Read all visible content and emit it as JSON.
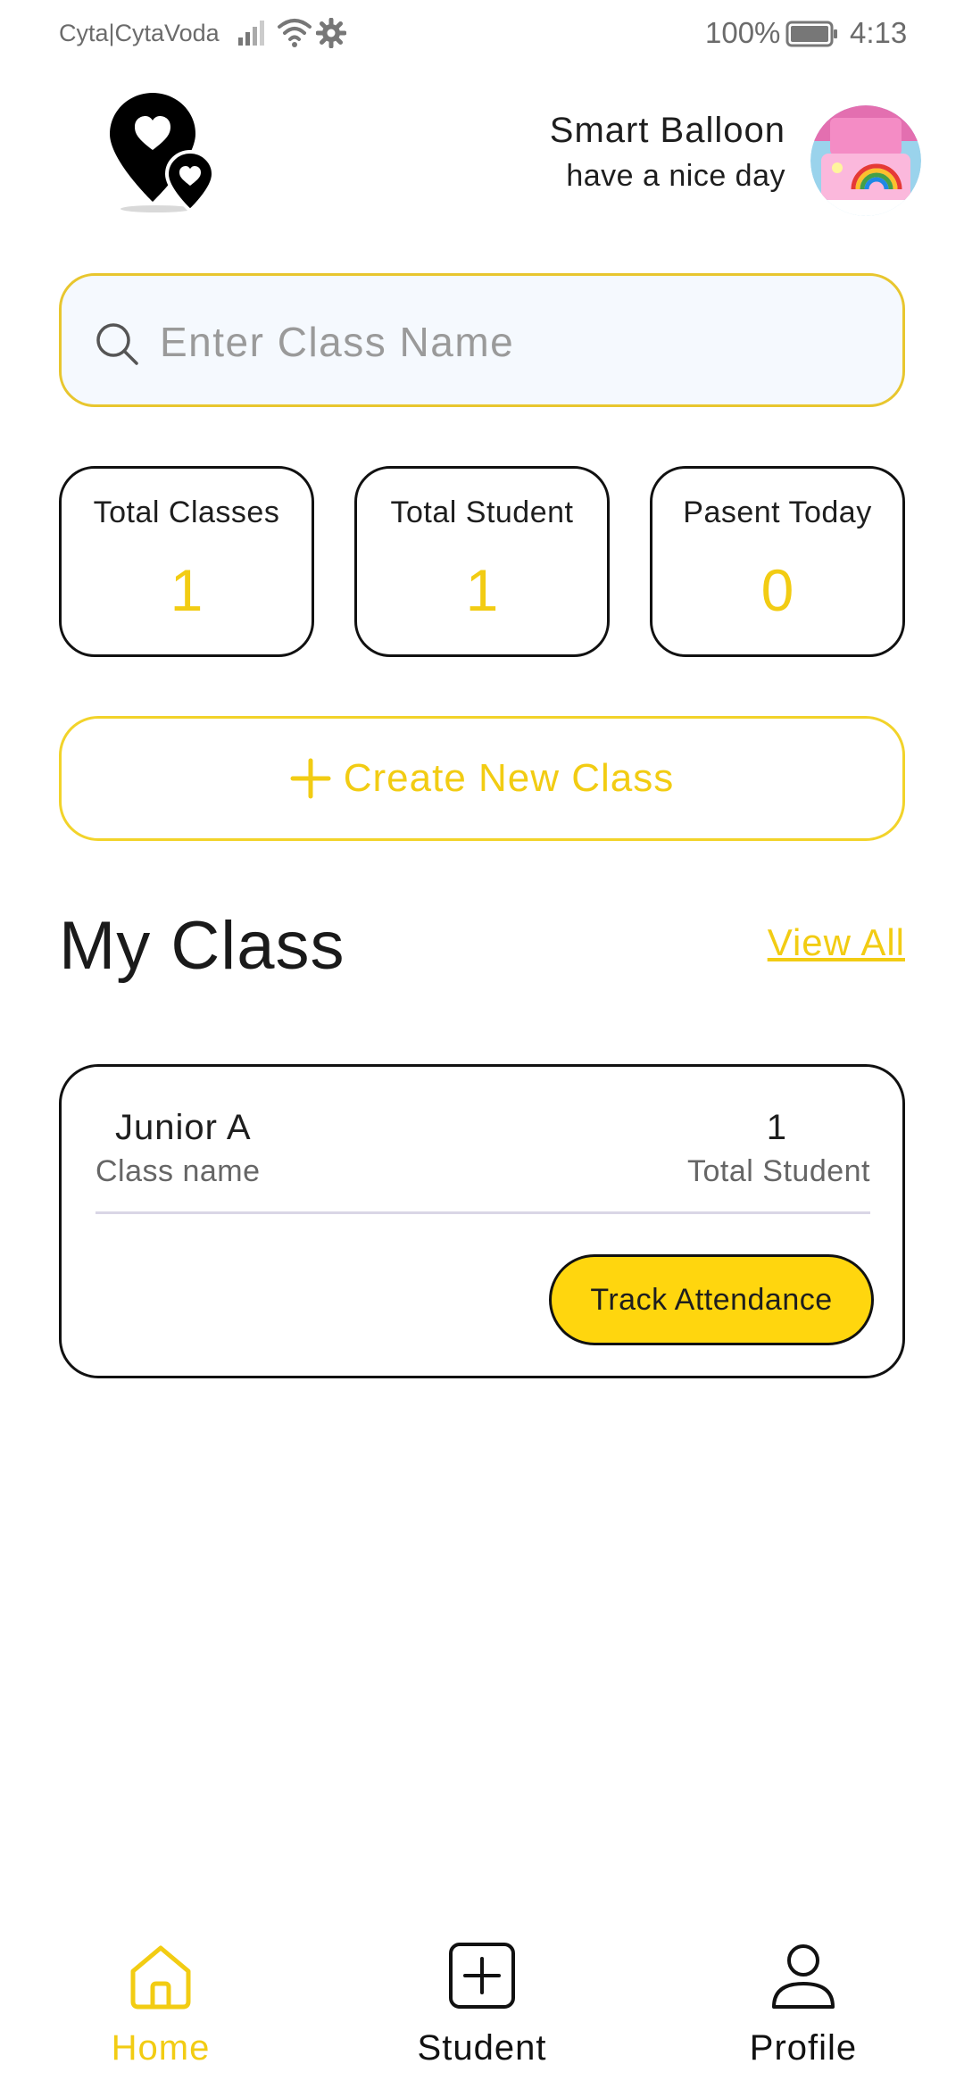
{
  "status_bar": {
    "carrier": "Cyta|CytaVoda",
    "battery": "100%",
    "time": "4:13"
  },
  "header": {
    "name": "Smart Balloon",
    "greeting": "have a nice day",
    "logo_icon": "location-hearts-icon",
    "avatar": "profile-photo"
  },
  "search": {
    "placeholder": "Enter Class Name",
    "value": ""
  },
  "stats": [
    {
      "label": "Total Classes",
      "value": "1"
    },
    {
      "label": "Total Student",
      "value": "1"
    },
    {
      "label": "Pasent Today",
      "value": "0"
    }
  ],
  "create_button": {
    "label": "Create New Class"
  },
  "section": {
    "title": "My Class",
    "view_all": "View All"
  },
  "classes": [
    {
      "name": "Junior A",
      "name_label": "Class name",
      "students": "1",
      "students_label": "Total Student",
      "action": "Track Attendance"
    }
  ],
  "nav": {
    "items": [
      {
        "label": "Home",
        "icon": "home-icon",
        "active": true
      },
      {
        "label": "Student",
        "icon": "add-square-icon",
        "active": false
      },
      {
        "label": "Profile",
        "icon": "user-icon",
        "active": false
      }
    ]
  },
  "colors": {
    "accent": "#f2cc13",
    "button_fill": "#ffd60e",
    "search_bg": "#f5f9fe",
    "border": "#111111"
  }
}
